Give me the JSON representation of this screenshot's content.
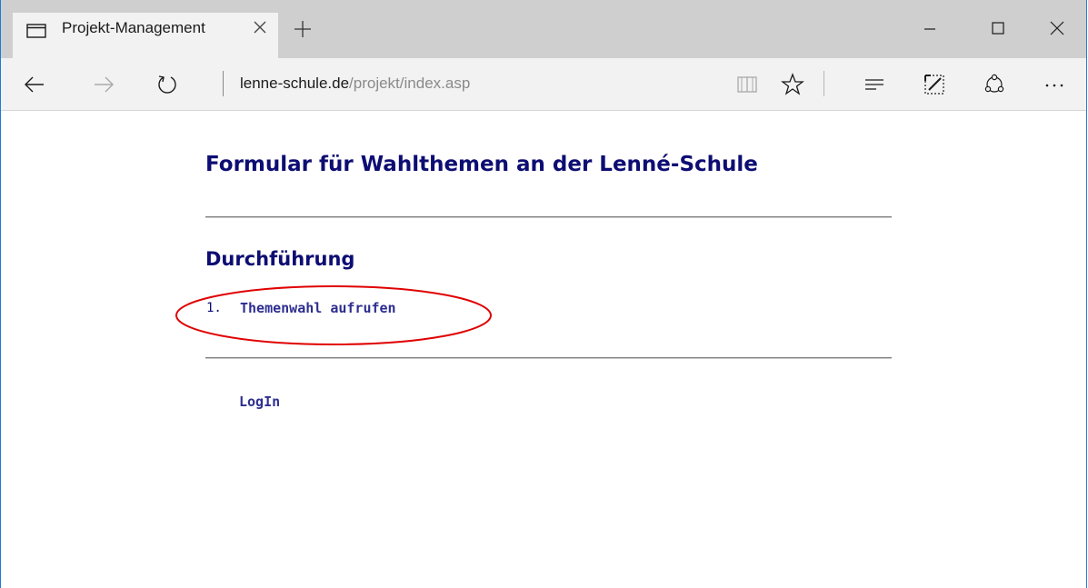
{
  "browser": {
    "tab": {
      "title": "Projekt-Management"
    },
    "address": {
      "domain": "lenne-schule.de",
      "path": "/projekt/index.asp"
    },
    "icons": {
      "tab": "tab-page-icon",
      "close_tab": "close-icon",
      "new_tab": "plus-icon",
      "minimize": "minimize-icon",
      "maximize": "maximize-icon",
      "close_window": "close-icon",
      "back": "arrow-left-icon",
      "forward": "arrow-right-icon",
      "refresh": "refresh-icon",
      "reading_view": "book-icon",
      "favorite": "star-icon",
      "hub": "hub-lines-icon",
      "web_note": "pen-note-icon",
      "share": "share-icon",
      "more": "more-dots-icon"
    }
  },
  "page": {
    "title": "Formular für Wahlthemen an der Lenné-Schule",
    "section_title": "Durchführung",
    "list": [
      {
        "number": "1.",
        "label": "Themenwahl aufrufen"
      }
    ],
    "login_label": "LogIn"
  },
  "colors": {
    "heading": "#0d0d73",
    "link": "#2e2e91",
    "highlight": "#e00000",
    "window_border": "#1e7ad6"
  }
}
